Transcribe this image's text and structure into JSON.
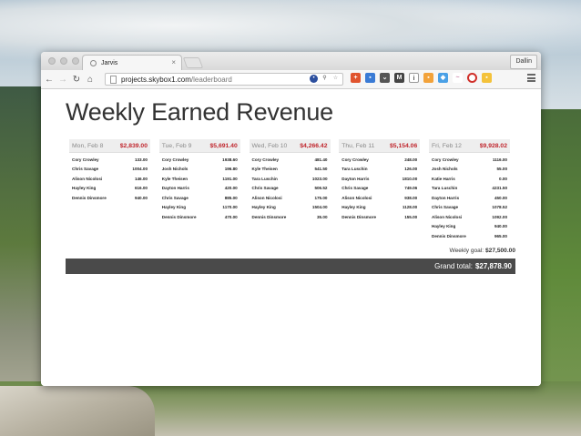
{
  "browser": {
    "tab_title": "Jarvis",
    "tab_close": "×",
    "user_button": "Dallin",
    "url_host": "projects.skybox1.com",
    "url_path": "/leaderboard"
  },
  "page": {
    "title": "Weekly Earned Revenue",
    "days": [
      {
        "name": "Mon, Feb 8",
        "total": "$2,839.00",
        "rows": [
          {
            "name": "Cory Crowley",
            "amount": "133.00"
          },
          {
            "name": "Chris Savage",
            "amount": "1004.00"
          },
          {
            "name": "Alison Nicolosi",
            "amount": "146.00"
          },
          {
            "name": "Hayley King",
            "amount": "616.00"
          },
          {
            "name": "Dennis Dinsmore",
            "amount": "940.00"
          }
        ]
      },
      {
        "name": "Tue, Feb 9",
        "total": "$5,691.40",
        "rows": [
          {
            "name": "Cory Crowley",
            "amount": "1938.60"
          },
          {
            "name": "Josh Nichols",
            "amount": "196.80"
          },
          {
            "name": "Kyle Theisen",
            "amount": "1191.00"
          },
          {
            "name": "Dayton Harris",
            "amount": "420.00"
          },
          {
            "name": "Chris Savage",
            "amount": "885.00"
          },
          {
            "name": "Hayley King",
            "amount": "1170.00"
          },
          {
            "name": "Dennis Dinsmore",
            "amount": "470.00"
          }
        ]
      },
      {
        "name": "Wed, Feb 10",
        "total": "$4,266.42",
        "rows": [
          {
            "name": "Cory Crowley",
            "amount": "481.40"
          },
          {
            "name": "Kyle Theisen",
            "amount": "541.50"
          },
          {
            "name": "Tara Luschin",
            "amount": "1023.00"
          },
          {
            "name": "Chris Savage",
            "amount": "506.52"
          },
          {
            "name": "Alison Nicolosi",
            "amount": "175.00"
          },
          {
            "name": "Hayley King",
            "amount": "1504.00"
          },
          {
            "name": "Dennis Dinsmore",
            "amount": "35.00"
          }
        ]
      },
      {
        "name": "Thu, Feb 11",
        "total": "$5,154.06",
        "rows": [
          {
            "name": "Cory Crowley",
            "amount": "248.00"
          },
          {
            "name": "Tara Luschin",
            "amount": "126.00"
          },
          {
            "name": "Dayton Harris",
            "amount": "1810.00"
          },
          {
            "name": "Chris Savage",
            "amount": "749.06"
          },
          {
            "name": "Alison Nicolosi",
            "amount": "938.00"
          },
          {
            "name": "Hayley King",
            "amount": "1128.00"
          },
          {
            "name": "Dennis Dinsmore",
            "amount": "155.00"
          }
        ]
      },
      {
        "name": "Fri, Feb 12",
        "total": "$9,928.02",
        "rows": [
          {
            "name": "Cory Crowley",
            "amount": "1116.00"
          },
          {
            "name": "Josh Nichols",
            "amount": "55.00"
          },
          {
            "name": "Katie Harris",
            "amount": "0.00"
          },
          {
            "name": "Tara Luschin",
            "amount": "4231.50"
          },
          {
            "name": "Dayton Harris",
            "amount": "450.00"
          },
          {
            "name": "Chris Savage",
            "amount": "1078.52"
          },
          {
            "name": "Alison Nicolosi",
            "amount": "1092.00"
          },
          {
            "name": "Hayley King",
            "amount": "940.00"
          },
          {
            "name": "Dennis Dinsmore",
            "amount": "965.00"
          }
        ]
      }
    ],
    "weekly_goal_label": "Weekly goal:",
    "weekly_goal_value": "$27,500.00",
    "grand_total_label": "Grand total:",
    "grand_total_value": "$27,878.90"
  },
  "colors": {
    "accent_red": "#c0262d",
    "grand_bar": "#4a4a4a"
  }
}
